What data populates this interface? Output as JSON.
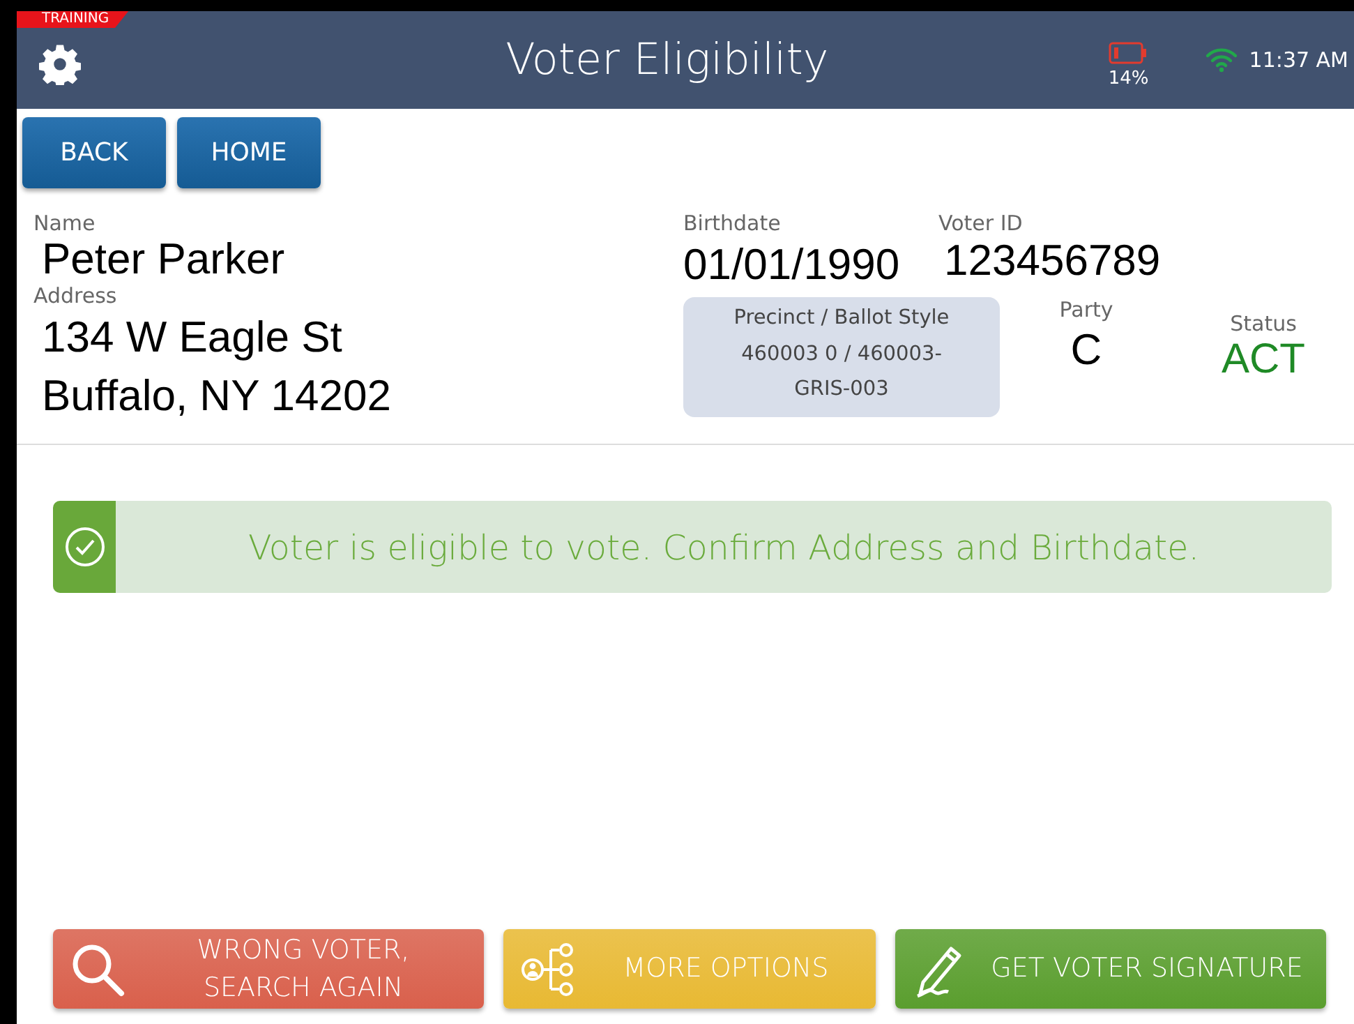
{
  "training_badge": "TRAINING",
  "header": {
    "title": "Voter Eligibility",
    "battery_reading": "14%",
    "battery_low": true,
    "time": "11:37 AM"
  },
  "nav_buttons": [
    "BACK",
    "HOME"
  ],
  "voter": {
    "name_label": "Name",
    "name": "Peter Parker",
    "address_label": "Address",
    "address_lines": [
      "134 W Eagle St",
      "Buffalo, NY 14202"
    ],
    "birthdate_label": "Birthdate",
    "birthdate": "01/01/1990",
    "voter_id_label": "Voter ID",
    "voter_id": "123456789",
    "precinct_label": "Precinct / Ballot Style",
    "precinct": "460003 0 / 460003-GRIS-003",
    "party_label": "Party",
    "party": "C",
    "status_label": "Status",
    "status": "ACT"
  },
  "alert": {
    "kind": "success",
    "message": "Voter is eligible to vote. Confirm Address and Birthdate."
  },
  "actions": [
    {
      "kind": "search",
      "color": "#d9604c",
      "label": "WRONG VOTER, SEARCH AGAIN"
    },
    {
      "kind": "options",
      "color": "#e8b933",
      "label": "MORE OPTIONS"
    },
    {
      "kind": "sign",
      "color": "#5a9e2e",
      "label": "GET VOTER SIGNATURE"
    }
  ]
}
